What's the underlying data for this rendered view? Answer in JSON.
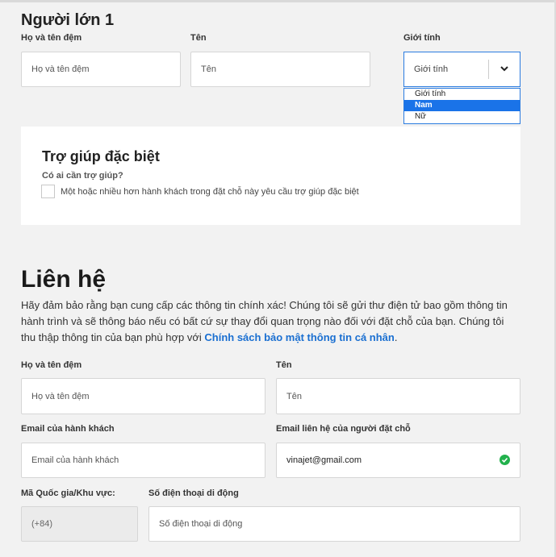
{
  "adult": {
    "title": "Người lớn 1",
    "last_first_label": "Họ và tên đệm",
    "last_first_placeholder": "Họ và tên đệm",
    "name_label": "Tên",
    "name_placeholder": "Tên",
    "gender_label": "Giới tính",
    "gender_value": "Giới tính",
    "gender_options": [
      "Giới tính",
      "Nam",
      "Nữ"
    ],
    "gender_highlighted": "Nam"
  },
  "special_help": {
    "title": "Trợ giúp đặc biệt",
    "question": "Có ai cần trợ giúp?",
    "checkbox_label": "Một hoặc nhiều hơn hành khách trong đặt chỗ này yêu cầu trợ giúp đặc biệt"
  },
  "contact": {
    "title": "Liên hệ",
    "intro": "Hãy đảm bảo rằng bạn cung cấp các thông tin chính xác! Chúng tôi sẽ gửi thư điện tử bao gồm thông tin hành trình và sẽ thông báo nếu có bất cứ sự thay đổi quan trọng nào đối với đặt chỗ của bạn. Chúng tôi thu thập thông tin của bạn phù hợp với ",
    "policy_link": "Chính sách bảo mật thông tin cá nhân",
    "intro_end": ".",
    "last_first_label": "Họ và tên đệm",
    "last_first_placeholder": "Họ và tên đệm",
    "name_label": "Tên",
    "name_placeholder": "Tên",
    "email_label": "Email của hành khách",
    "email_placeholder": "Email của hành khách",
    "booker_email_label": "Email liên hệ của người đặt chỗ",
    "booker_email_value": "vinajet@gmail.com",
    "country_code_label": "Mã Quốc gia/Khu vực:",
    "country_code_value": "(+84)",
    "phone_label": "Số điện thoại di động",
    "phone_placeholder": "Số điện thoại di động"
  },
  "colors": {
    "accent": "#1a73e8",
    "link": "#1a6fd1",
    "success": "#22b14c"
  }
}
